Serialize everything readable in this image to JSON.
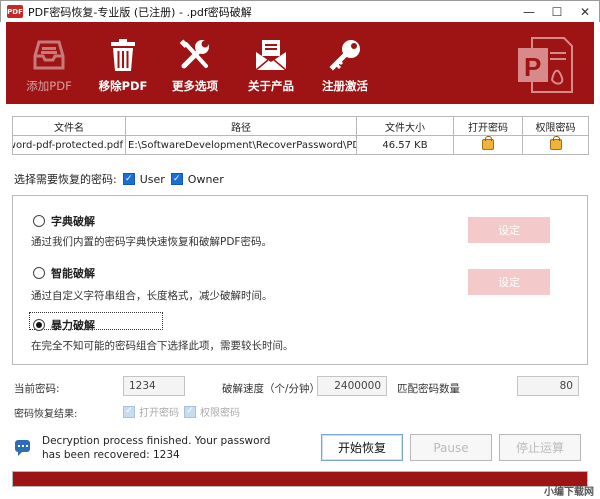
{
  "window": {
    "title": "PDF密码恢复-专业版 (已注册) - .pdf密码破解",
    "app_icon_text": "PDF",
    "minimize": "—",
    "maximize": "☐",
    "close": "✕"
  },
  "toolbar": {
    "items": [
      {
        "label": "添加PDF",
        "icon": "inbox-tray-icon",
        "enabled": false
      },
      {
        "label": "移除PDF",
        "icon": "trash-icon",
        "enabled": true
      },
      {
        "label": "更多选项",
        "icon": "tools-icon",
        "enabled": true
      },
      {
        "label": "关于产品",
        "icon": "envelope-icon",
        "enabled": true
      },
      {
        "label": "注册激活",
        "icon": "key-icon",
        "enabled": true
      }
    ],
    "logo_text": "P",
    "background": "#9e1414"
  },
  "file_table": {
    "headers": [
      "文件名",
      "路径",
      "文件大小",
      "打开密码",
      "权限密码"
    ],
    "rows": [
      {
        "name": "password-pdf-protected.pdf",
        "path": "E:\\SoftwareDevelopment\\RecoverPassword\\PDF Pass",
        "size": "46.57 KB",
        "open_password": "lock-icon",
        "permission_password": "lock-icon"
      }
    ]
  },
  "recover_select": {
    "label": "选择需要恢复的密码:",
    "user": {
      "label": "User",
      "checked": true
    },
    "owner": {
      "label": "Owner",
      "checked": true
    }
  },
  "modes": [
    {
      "title": "字典破解",
      "desc": "通过我们内置的密码字典快速恢复和破解PDF密码。",
      "selected": false,
      "button": "设定"
    },
    {
      "title": "智能破解",
      "desc": "通过自定义字符串组合，长度格式，减少破解时间。",
      "selected": false,
      "button": "设定"
    },
    {
      "title": "暴力破解",
      "desc": "在完全不知可能的密码组合下选择此项，需要较长时间。",
      "selected": true
    }
  ],
  "stats": {
    "current_label": "当前密码:",
    "current_value": "1234",
    "speed_label": "破解速度（个/分钟）",
    "speed_value": "2400000",
    "match_label": "匹配密码数量",
    "match_value": "80",
    "result_label": "密码恢复结果:",
    "result_open": "打开密码",
    "result_permission": "权限密码"
  },
  "message": "Decryption process finished. Your password has been recovered: 1234",
  "buttons": {
    "start": "开始恢复",
    "pause": "Pause",
    "stop": "停止运算"
  },
  "progress": {
    "fraction": 1.0
  },
  "watermark": "小编下载网"
}
